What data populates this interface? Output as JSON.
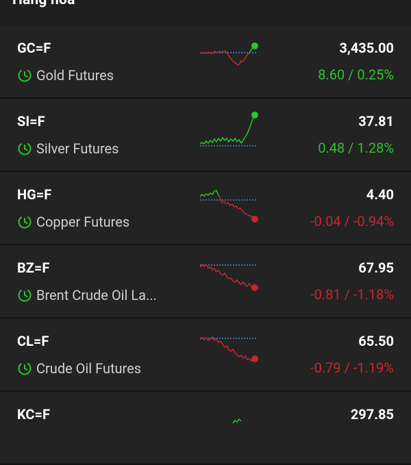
{
  "header": {
    "title": "Hàng hóa"
  },
  "colors": {
    "up": "#2ec32e",
    "down": "#c8262e",
    "baseline": "#4aa3ff",
    "background": "#232323"
  },
  "items": [
    {
      "symbol": "GC=F",
      "name": "Gold Futures",
      "price": "3,435.00",
      "change": "8.60 / 0.25%",
      "direction": "up"
    },
    {
      "symbol": "SI=F",
      "name": "Silver Futures",
      "price": "37.81",
      "change": "0.48 / 1.28%",
      "direction": "up"
    },
    {
      "symbol": "HG=F",
      "name": "Copper Futures",
      "price": "4.40",
      "change": "-0.04 / -0.94%",
      "direction": "down"
    },
    {
      "symbol": "BZ=F",
      "name": "Brent Crude Oil La...",
      "price": "67.95",
      "change": "-0.81 / -1.18%",
      "direction": "down"
    },
    {
      "symbol": "CL=F",
      "name": "Crude Oil Futures",
      "price": "65.50",
      "change": "-0.79 / -1.19%",
      "direction": "down"
    },
    {
      "symbol": "KC=F",
      "name": "",
      "price": "297.85",
      "change": "",
      "direction": "up"
    }
  ]
}
